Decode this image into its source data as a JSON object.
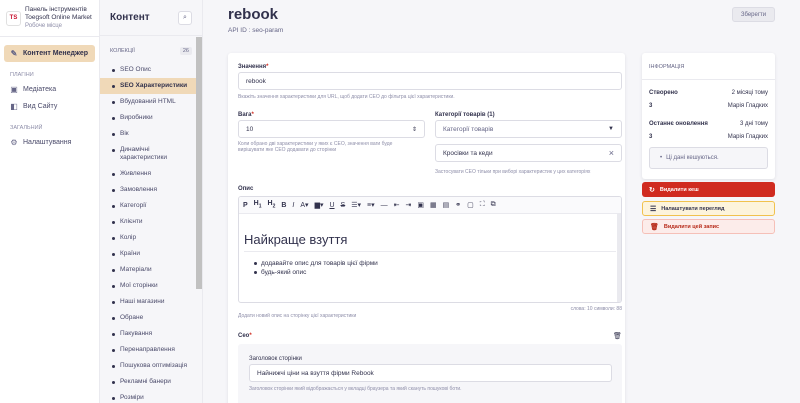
{
  "brand": {
    "line1": "Панель інструментів",
    "line2": "Toegsoft Online Market",
    "sub": "Робоче місце",
    "logo_text": "TS"
  },
  "nav": {
    "content_manager": "Контент Менеджер",
    "plugins_label": "ПЛАГІНИ",
    "media": "Медіатека",
    "site_view": "Вид Сайту",
    "general_label": "ЗАГАЛЬНИЙ",
    "settings": "Налаштування"
  },
  "content_panel": {
    "title": "Контент",
    "collections_label": "КОЛЕКЦІЇ",
    "collections_count": "26",
    "items": [
      "SEO Опис",
      "SEO Характеристики",
      "Вбудований HTML",
      "Виробники",
      "Вік",
      "Динамічні характеристики",
      "Живлення",
      "Замовлення",
      "Категорії",
      "Клієнти",
      "Колір",
      "Країни",
      "Матеріали",
      "Мої сторінки",
      "Наші магазини",
      "Обране",
      "Пакування",
      "Перенаправлення",
      "Пошукова оптимізація",
      "Рекламні банери",
      "Розміри"
    ]
  },
  "page": {
    "title": "rebook",
    "api_id": "API ID : seo-param",
    "save": "Зберегти"
  },
  "form": {
    "value_label": "Значення",
    "value": "rebook",
    "value_hint": "Вкажіть значення характеристики для URL, щоб додати СЕО до фільтра цієї характеристики.",
    "weight_label": "Вага",
    "weight": "10",
    "weight_hint": "Коли обрано дві характеристики у яких є СЕО, значення ваги буде вирішувати яке СЕО додавати до сторінки",
    "category_label": "Категорії товарів (1)",
    "category_placeholder": "Категорії товарів",
    "category_selected": "Кросівки та кеди",
    "category_hint": "Застосувати СЕО тільки при виборі характеристик у цих категоріях",
    "desc_label": "Опис",
    "editor_heading": "Найкраще взуття",
    "editor_list": [
      "додавайте опис для товарів цієї фірми",
      "будь-який опис"
    ],
    "editor_count": "слова: 10  символи: 88",
    "desc_hint": "Додати новий опис на сторінку цієї характеристики",
    "seo_label": "Сео",
    "page_title_label": "Заголовок сторінки",
    "page_title_value": "Найнижчі ціни на взуття фірми Rebook",
    "page_title_hint": "Заголовок сторінки який відображається у вкладці браузера та який скануть пошукові боти."
  },
  "info": {
    "label": "ІНФОРМАЦІЯ",
    "created_label": "Створено",
    "created_value": "2 місяці тому",
    "created_by_id": "3",
    "created_by": "Марія Гладких",
    "updated_label": "Останнє оновлення",
    "updated_value": "3 дні тому",
    "updated_by_id": "3",
    "updated_by": "Марія Гладких",
    "cache_note": "Ці дані кешуються."
  },
  "actions": {
    "delete_cache": "Видалити кеш",
    "configure_view": "Налаштувати перегляд",
    "delete_record": "Видалити цей запис"
  },
  "colors": {
    "accent": "#f0d9b8",
    "danger": "#d02b20"
  }
}
